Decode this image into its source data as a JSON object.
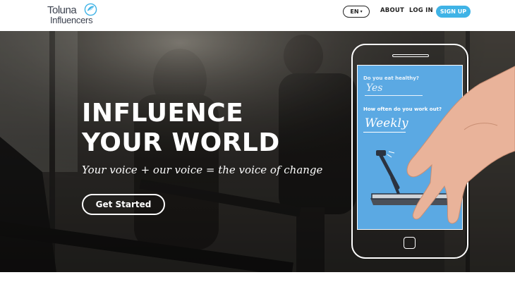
{
  "header": {
    "logo": {
      "line1": "Toluna",
      "line2": "Influencers"
    },
    "language": {
      "label": "EN",
      "caret": "▾"
    },
    "nav": {
      "about": "ABOUT",
      "login": "LOG IN",
      "signup": "SIGN UP"
    }
  },
  "hero": {
    "title_line1": "INFLUENCE",
    "title_line2": "YOUR WORLD",
    "tagline": "Your voice + our voice = the voice of change",
    "cta": "Get Started",
    "phone": {
      "question1": "Do you eat healthy?",
      "answer1": "Yes",
      "question2": "How often do you work out?",
      "answer2": "Weekly"
    }
  },
  "colors": {
    "accent": "#3fb3e6",
    "phone_screen": "#5ba9e3",
    "text_dark": "#222222"
  }
}
